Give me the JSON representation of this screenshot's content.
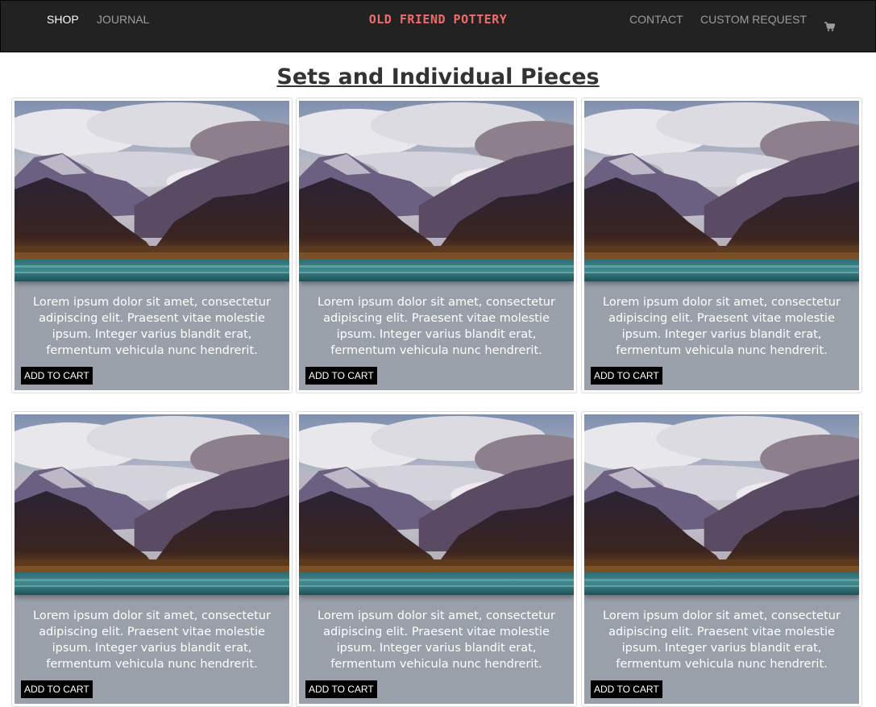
{
  "nav": {
    "left": [
      {
        "label": "SHOP",
        "active": true
      },
      {
        "label": "JOURNAL",
        "active": false
      }
    ],
    "brand": "OLD FRIEND POTTERY",
    "right": [
      {
        "label": "CONTACT"
      },
      {
        "label": "CUSTOM REQUEST"
      }
    ],
    "cart_icon": "shopping-cart-icon"
  },
  "page": {
    "title": "Sets and Individual Pieces"
  },
  "products": [
    {
      "description": "Lorem ipsum dolor sit amet, consectetur adipiscing elit. Praesent vitae molestie ipsum. Integer varius blandit erat, fermentum vehicula nunc hendrerit.",
      "button_label": "ADD TO CART",
      "image": "mountain-lake-photo"
    },
    {
      "description": "Lorem ipsum dolor sit amet, consectetur adipiscing elit. Praesent vitae molestie ipsum. Integer varius blandit erat, fermentum vehicula nunc hendrerit.",
      "button_label": "ADD TO CART",
      "image": "mountain-lake-photo"
    },
    {
      "description": "Lorem ipsum dolor sit amet, consectetur adipiscing elit. Praesent vitae molestie ipsum. Integer varius blandit erat, fermentum vehicula nunc hendrerit.",
      "button_label": "ADD TO CART",
      "image": "mountain-lake-photo"
    },
    {
      "description": "Lorem ipsum dolor sit amet, consectetur adipiscing elit. Praesent vitae molestie ipsum. Integer varius blandit erat, fermentum vehicula nunc hendrerit.",
      "button_label": "ADD TO CART",
      "image": "mountain-lake-photo"
    },
    {
      "description": "Lorem ipsum dolor sit amet, consectetur adipiscing elit. Praesent vitae molestie ipsum. Integer varius blandit erat, fermentum vehicula nunc hendrerit.",
      "button_label": "ADD TO CART",
      "image": "mountain-lake-photo"
    },
    {
      "description": "Lorem ipsum dolor sit amet, consectetur adipiscing elit. Praesent vitae molestie ipsum. Integer varius blandit erat, fermentum vehicula nunc hendrerit.",
      "button_label": "ADD TO CART",
      "image": "mountain-lake-photo"
    }
  ],
  "colors": {
    "navbar_bg": "#222222",
    "nav_link": "#9d9d9d",
    "nav_link_active": "#ffffff",
    "brand": "#f26b6b",
    "card_bg": "#9aa0aa",
    "button_bg": "#000000"
  }
}
